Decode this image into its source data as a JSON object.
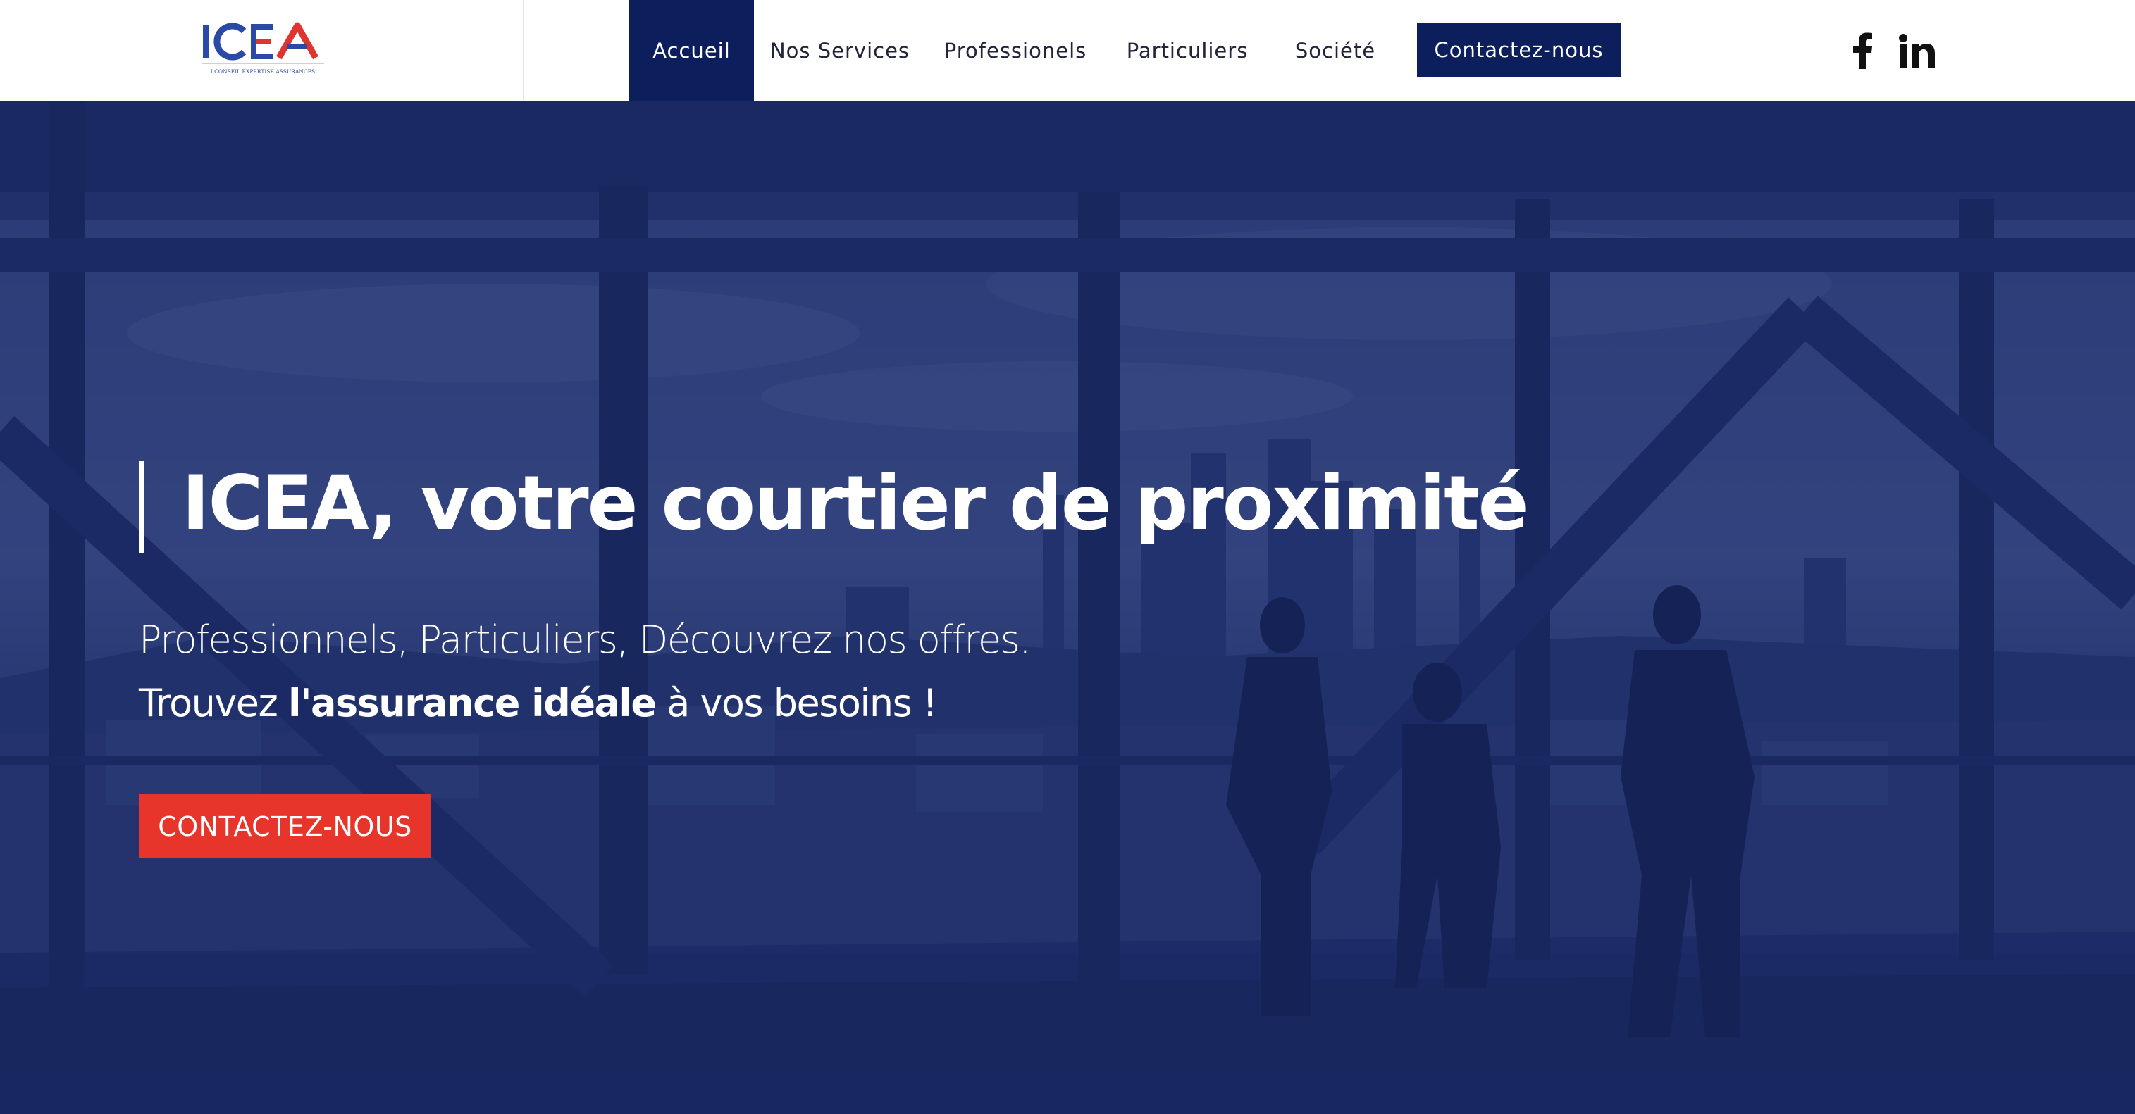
{
  "header": {
    "logo": {
      "text": "ICEA",
      "tagline": "I CONSEIL EXPERTISE ASSURANCES"
    },
    "nav": [
      {
        "label": "Accueil",
        "active": true
      },
      {
        "label": "Nos Services",
        "active": false
      },
      {
        "label": "Professionels",
        "active": false
      },
      {
        "label": "Particuliers",
        "active": false
      },
      {
        "label": "Société",
        "active": false
      }
    ],
    "cta_label": "Contactez-nous",
    "social": [
      "facebook-icon",
      "linkedin-icon"
    ]
  },
  "hero": {
    "title": "ICEA, votre courtier de proximité",
    "line1": "Professionnels, Particuliers, Découvrez nos offres.",
    "line2_prefix": "Trouvez ",
    "line2_bold": "l'assurance idéale",
    "line2_suffix": " à vos besoins !",
    "button_label": "CONTACTEZ-NOUS"
  },
  "colors": {
    "navy": "#0d1e5c",
    "accent_red": "#e8352b",
    "logo_blue": "#2b4aa8",
    "logo_red": "#e0342f"
  }
}
